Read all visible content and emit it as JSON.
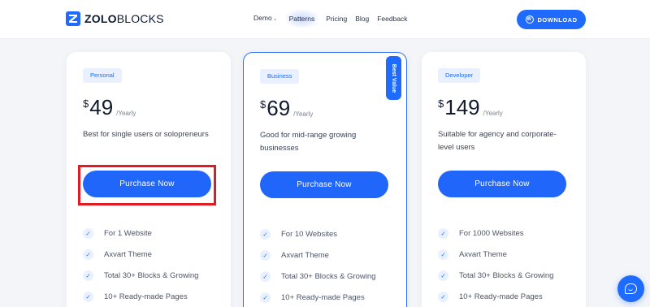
{
  "header": {
    "logo_strong": "ZOLO",
    "logo_light": "BLOCKS",
    "nav": [
      {
        "label": "Demo",
        "has_caret": true
      },
      {
        "label": "Patterns",
        "active": true
      },
      {
        "label": "Pricing"
      },
      {
        "label": "Blog"
      },
      {
        "label": "Feedback"
      }
    ],
    "download_label": "DOWNLOAD",
    "download_icon": "wordpress-icon"
  },
  "plans": [
    {
      "badge": "Personal",
      "currency": "$",
      "amount": "49",
      "period": "/Yearly",
      "description": "Best for single users or solopreneurs",
      "button": "Purchase Now",
      "features": [
        "For 1 Website",
        "Axvart Theme",
        "Total 30+ Blocks & Growing",
        "10+ Ready-made Pages"
      ]
    },
    {
      "badge": "Business",
      "ribbon": "Best Value",
      "currency": "$",
      "amount": "69",
      "period": "/Yearly",
      "description": "Good for mid-range growing businesses",
      "button": "Purchase Now",
      "features": [
        "For 10 Websites",
        "Axvart Theme",
        "Total 30+ Blocks & Growing",
        "10+ Ready-made Pages"
      ]
    },
    {
      "badge": "Developer",
      "currency": "$",
      "amount": "149",
      "period": "/Yearly",
      "description": "Suitable for agency and corporate-level users",
      "button": "Purchase Now",
      "features": [
        "For 1000 Websites",
        "Axvart Theme",
        "Total 30+ Blocks & Growing",
        "10+ Ready-made Pages"
      ]
    }
  ],
  "colors": {
    "accent": "#1f6bff",
    "highlight": "#e01b24",
    "background": "#f3f5f9"
  },
  "icons": {
    "feature_check": "check-icon",
    "chat": "chat-icon"
  }
}
